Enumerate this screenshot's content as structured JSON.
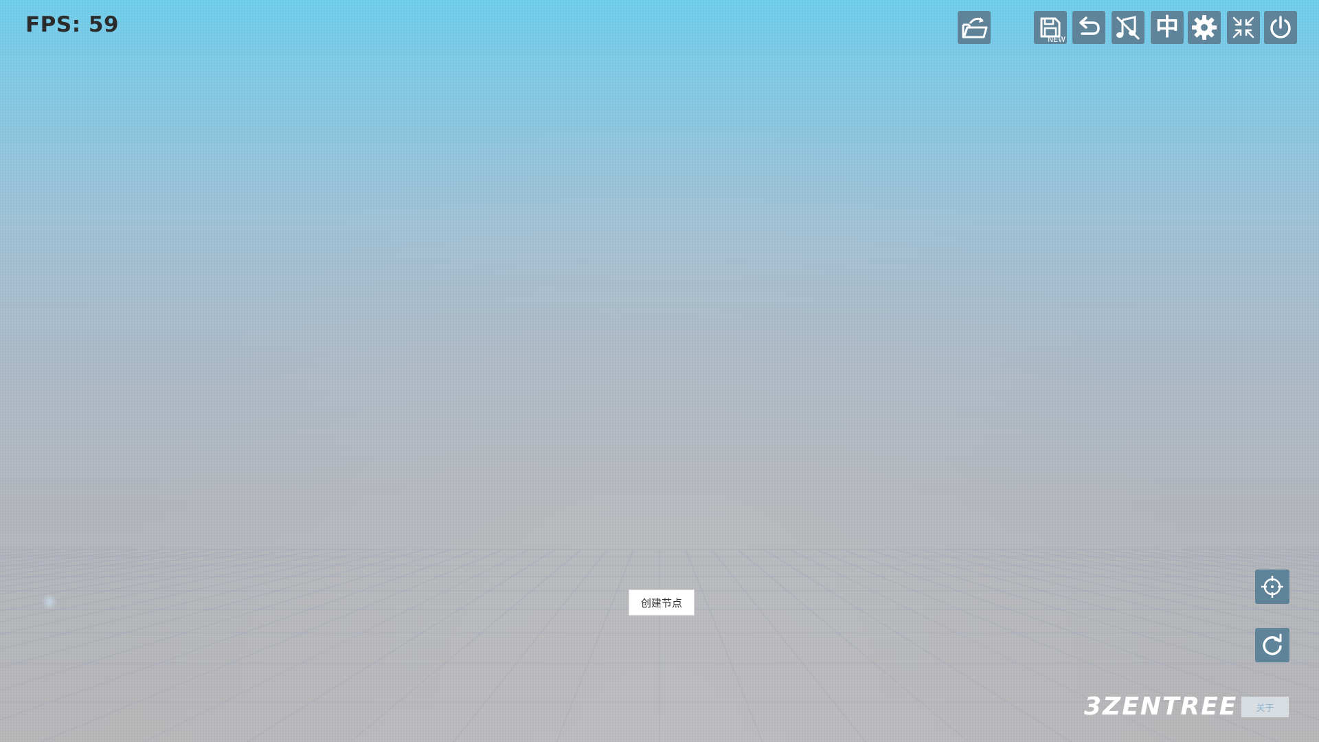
{
  "fps": {
    "label": "FPS: 59"
  },
  "toolbar": {
    "open_icon": "open-folder-icon",
    "save_new_icon": "save-icon",
    "save_new_tag": "NEW",
    "undo_icon": "undo-icon",
    "music_icon": "music-off-icon",
    "language_label": "中",
    "settings_icon": "gear-icon",
    "exit_fullscreen_icon": "compress-icon",
    "power_icon": "power-icon"
  },
  "canvas": {
    "create_node_label": "创建节点"
  },
  "side_controls": {
    "locate_icon": "crosshair-icon",
    "reset_icon": "refresh-icon"
  },
  "brand": {
    "logo_text": "3ZENTREE",
    "about_label": "关于"
  },
  "colors": {
    "button_bg": "#5f8499",
    "sky_top": "#6ccbea",
    "ground": "#b5b4b6"
  }
}
